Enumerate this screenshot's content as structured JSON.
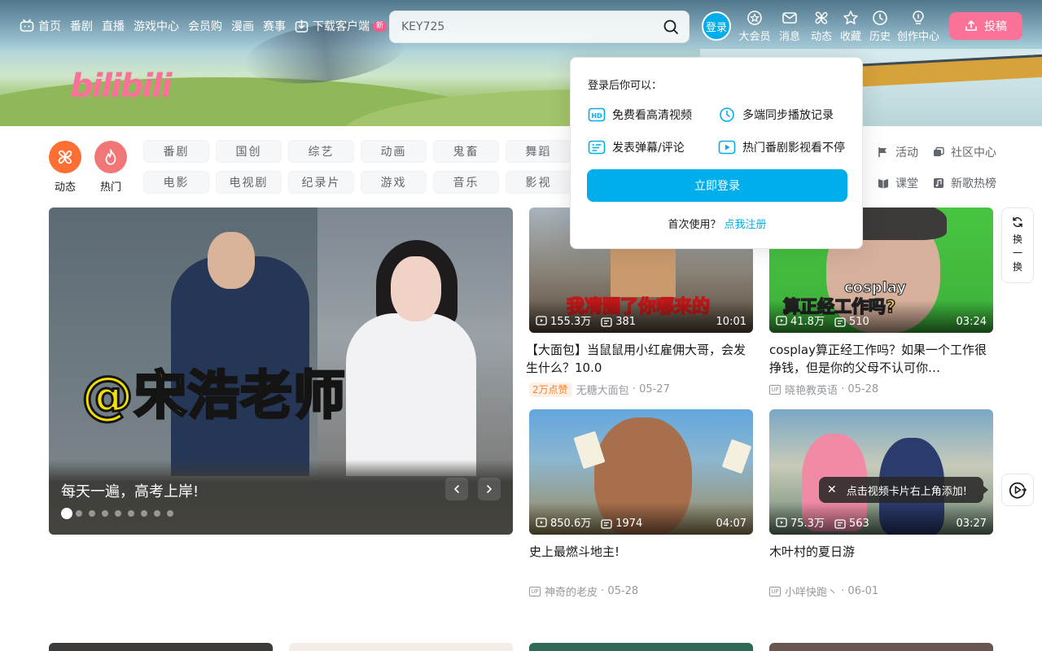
{
  "header": {
    "nav_left": [
      {
        "label": "首页",
        "icon": "tv-icon"
      },
      {
        "label": "番剧"
      },
      {
        "label": "直播"
      },
      {
        "label": "游戏中心"
      },
      {
        "label": "会员购"
      },
      {
        "label": "漫画"
      },
      {
        "label": "赛事"
      },
      {
        "label": "下载客户端",
        "icon": "download-icon",
        "badge": "新"
      }
    ],
    "search_placeholder": "KEY725",
    "login_label": "登录",
    "nav_right": [
      {
        "label": "大会员",
        "icon": "vip-icon"
      },
      {
        "label": "消息",
        "icon": "message-icon"
      },
      {
        "label": "动态",
        "icon": "fan-icon"
      },
      {
        "label": "收藏",
        "icon": "star-icon"
      },
      {
        "label": "历史",
        "icon": "clock-icon"
      },
      {
        "label": "创作中心",
        "icon": "bulb-icon"
      }
    ],
    "upload_label": "投稿",
    "brand_color": "#fb7299",
    "accent_color": "#00aeec"
  },
  "channels": {
    "dynamic_label": "动态",
    "hot_label": "热门",
    "row1": [
      "番剧",
      "国创",
      "综艺",
      "动画",
      "鬼畜",
      "舞蹈"
    ],
    "row2": [
      "电影",
      "电视剧",
      "纪录片",
      "游戏",
      "音乐",
      "影视"
    ],
    "links_row1": [
      "活动",
      "社区中心"
    ],
    "links_row2": [
      "课堂",
      "新歌热榜"
    ]
  },
  "carousel": {
    "title": "每天一遍，高考上岸!",
    "overlay_text": "@宋浩老师",
    "dot_count": 9,
    "active_dot": 0
  },
  "videos": [
    {
      "title": "【大面包】当鼠鼠用小红雇佣大哥，会发生什么？10.0",
      "views": "155.3万",
      "danmaku": "381",
      "duration": "10:01",
      "likes": "2万点赞",
      "author": "无糖大面包",
      "date": "05-27",
      "thumb_text": "我凊圈了你哪来的"
    },
    {
      "title": "cosplay算正经工作吗？如果一个工作很挣钱，但是你的父母不认可你…",
      "views": "41.8万",
      "danmaku": "510",
      "duration": "03:24",
      "likes": "",
      "author": "晓艳教英语",
      "date": "05-28",
      "thumb_text": "cosplay",
      "thumb_text2": "算正经工作吗?"
    },
    {
      "title": "史上最燃斗地主!",
      "views": "850.6万",
      "danmaku": "1974",
      "duration": "04:07",
      "likes": "",
      "author": "神奇的老皮",
      "date": "05-28"
    },
    {
      "title": "木叶村的夏日游",
      "views": "75.3万",
      "danmaku": "563",
      "duration": "03:27",
      "likes": "",
      "author": "小咩快跑丶",
      "date": "06-01"
    }
  ],
  "login_popup": {
    "title": "登录后你可以：",
    "features": [
      {
        "label": "免费看高清视频",
        "icon": "hd-icon"
      },
      {
        "label": "多端同步播放记录",
        "icon": "clock-icon"
      },
      {
        "label": "发表弹幕/评论",
        "icon": "danmaku-icon"
      },
      {
        "label": "热门番剧影视看不停",
        "icon": "play-icon"
      }
    ],
    "button": "立即登录",
    "first_use": "首次使用？",
    "register": "点我注册"
  },
  "floating": {
    "refresh": "换一换",
    "tip": "点击视频卡片右上角添加!",
    "tip_close": "✕"
  }
}
